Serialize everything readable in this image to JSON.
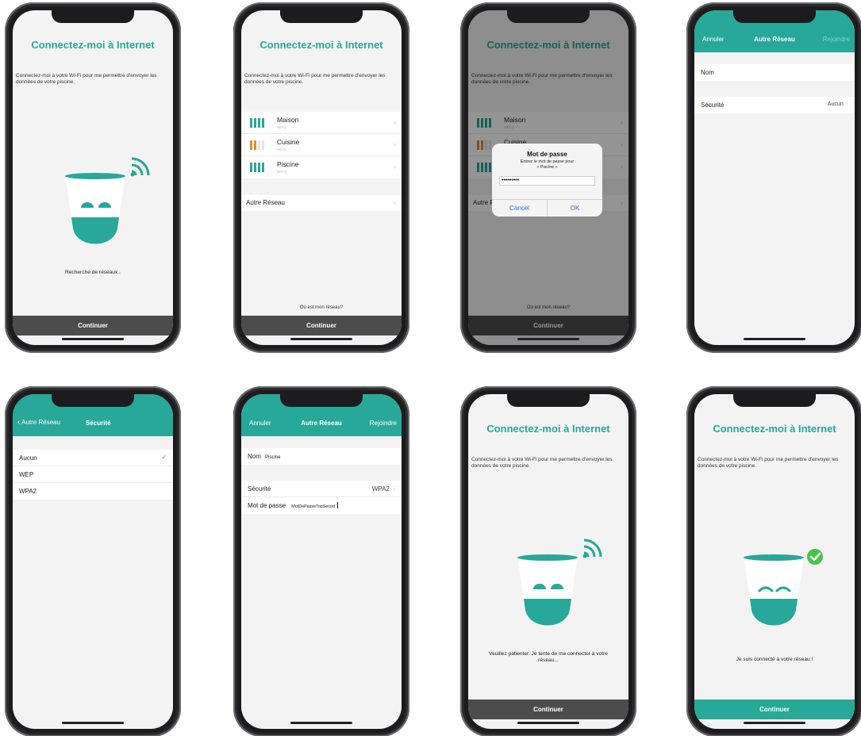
{
  "common": {
    "title": "Connectez-moi à Internet",
    "intro": "Connectez-moi à votre Wi-Fi pour me permettre d'envoyer les données de votre piscine.",
    "continue_label": "Continuer"
  },
  "screen1": {
    "status": "Recherche de réseaux.."
  },
  "screen2": {
    "networks": [
      {
        "name": "Maison",
        "security": "WPA2"
      },
      {
        "name": "Cuisine",
        "security": "WPA2"
      },
      {
        "name": "Piscine",
        "security": "WPA2"
      }
    ],
    "other_network": "Autre Réseau",
    "where_label": "Où est mon réseau?"
  },
  "screen3": {
    "dialog_title": "Mot de passe",
    "dialog_msg_line1": "Entrez le mot de passe pour",
    "dialog_msg_line2": "« Piscine »",
    "password_mask": "•••••••••",
    "cancel_label": "Cancel",
    "ok_label": "OK"
  },
  "screen4": {
    "nav_left": "Annuler",
    "nav_title": "Autre Réseau",
    "nav_right": "Rejoindre",
    "name_label": "Nom",
    "security_label": "Sécurité",
    "security_value": "Aucun"
  },
  "screen5": {
    "nav_back": "Autre Réseau",
    "nav_title": "Sécurité",
    "options": [
      "Aucun",
      "WEP",
      "WPA2"
    ]
  },
  "screen6": {
    "name_value": "Piscine",
    "security_value": "WPA2",
    "password_label": "Mot de passe",
    "password_value": "MotDePasseTopSecret"
  },
  "screen7": {
    "status": "Veuillez patienter. Je tente de me connecter à votre réseau..."
  },
  "screen8": {
    "status": "Je suis connecté à votre réseau !"
  },
  "colors": {
    "accent": "#27a899",
    "button_dark": "#4c4c4c",
    "signal_orange": "#e8892b",
    "success_green": "#4bc248",
    "ios_blue": "#2e6fd8"
  }
}
